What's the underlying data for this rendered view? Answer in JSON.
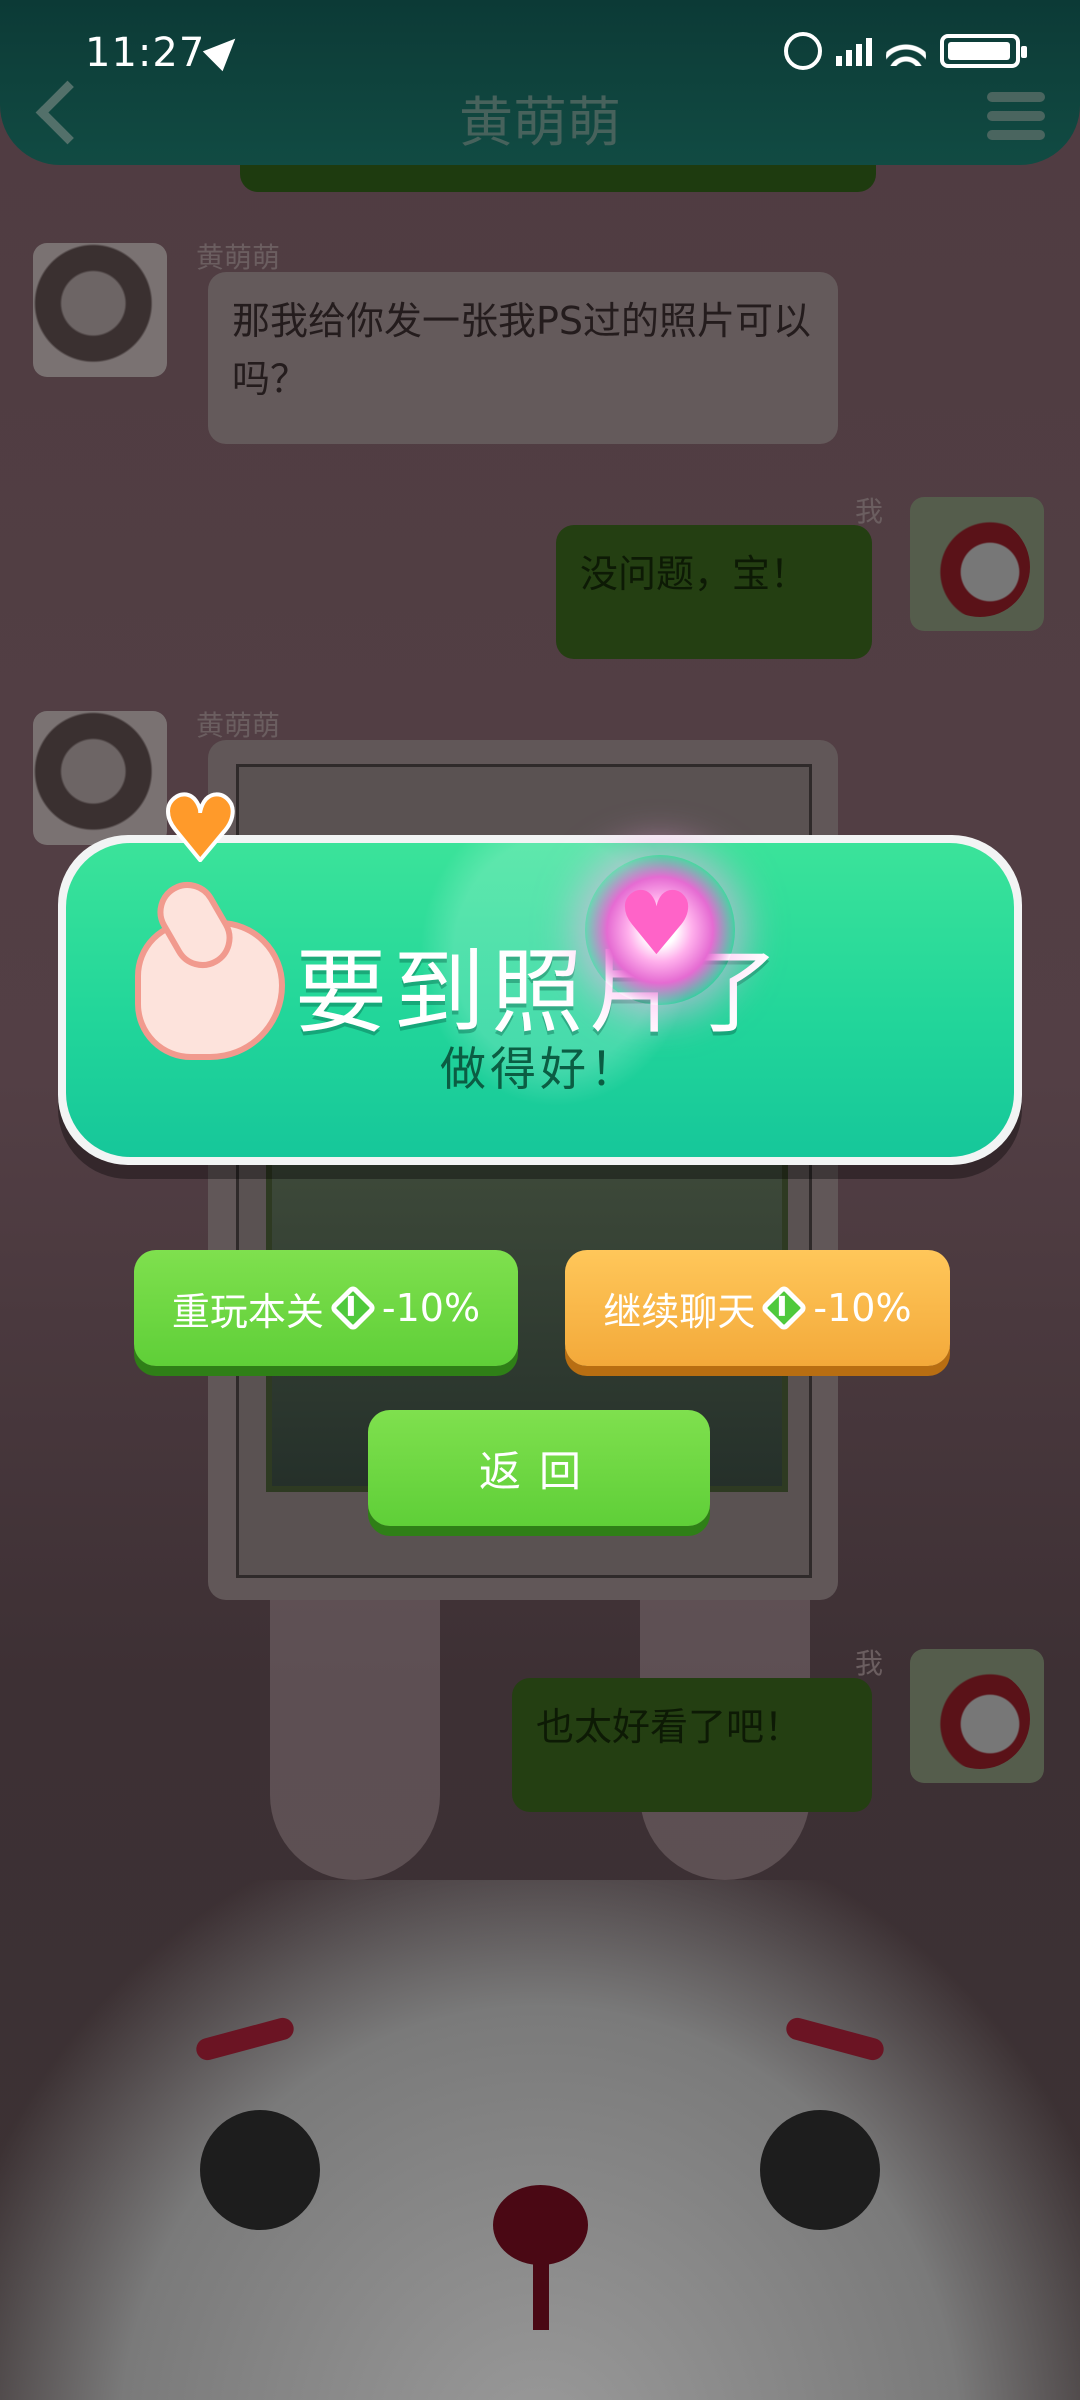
{
  "status_bar": {
    "time": "11:27"
  },
  "header": {
    "title": "黄萌萌"
  },
  "chat": {
    "messages": [
      {
        "sender": "黄萌萌",
        "text": "那我给你发一张我PS过的照片可以吗？"
      },
      {
        "sender": "我",
        "text": "没问题，宝！"
      },
      {
        "sender": "黄萌萌",
        "text": ""
      },
      {
        "sender": "我",
        "text": "也太好看了吧！"
      }
    ]
  },
  "popup": {
    "title": "要到照片了",
    "subtitle": "做得好！"
  },
  "buttons": {
    "replay_label": "重玩本关",
    "replay_cost": "-10%",
    "continue_label": "继续聊天",
    "continue_cost": "-10%",
    "back_label": "返回"
  },
  "colors": {
    "popup_green": "#22d69a",
    "button_green": "#6ad643",
    "button_orange": "#f5b04a",
    "header_bg": "#0f423c"
  },
  "icons": [
    "back-icon",
    "menu-icon",
    "alarm-icon",
    "signal-icon",
    "wifi-icon",
    "battery-icon",
    "heart-icon",
    "finger-heart-icon",
    "energy-icon"
  ]
}
